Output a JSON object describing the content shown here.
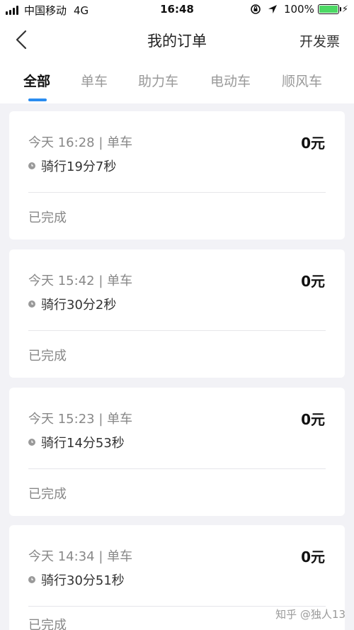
{
  "status_bar": {
    "carrier": "中国移动",
    "network": "4G",
    "time": "16:48",
    "battery": "100%"
  },
  "nav": {
    "title": "我的订单",
    "action": "开发票"
  },
  "tabs": [
    {
      "label": "全部",
      "active": true
    },
    {
      "label": "单车",
      "active": false
    },
    {
      "label": "助力车",
      "active": false
    },
    {
      "label": "电动车",
      "active": false
    },
    {
      "label": "顺风车",
      "active": false
    }
  ],
  "orders": [
    {
      "time": "今天 16:28 | 单车",
      "price": "0元",
      "duration": "骑行19分7秒",
      "status": "已完成"
    },
    {
      "time": "今天 15:42 | 单车",
      "price": "0元",
      "duration": "骑行30分2秒",
      "status": "已完成"
    },
    {
      "time": "今天 15:23 | 单车",
      "price": "0元",
      "duration": "骑行14分53秒",
      "status": "已完成"
    },
    {
      "time": "今天 14:34 | 单车",
      "price": "0元",
      "duration": "骑行30分51秒",
      "status": "已完成"
    }
  ],
  "watermark": "知乎 @独人13",
  "colors": {
    "accent": "#2a8cf0",
    "background": "#f2f2f6",
    "battery": "#4cd964"
  }
}
